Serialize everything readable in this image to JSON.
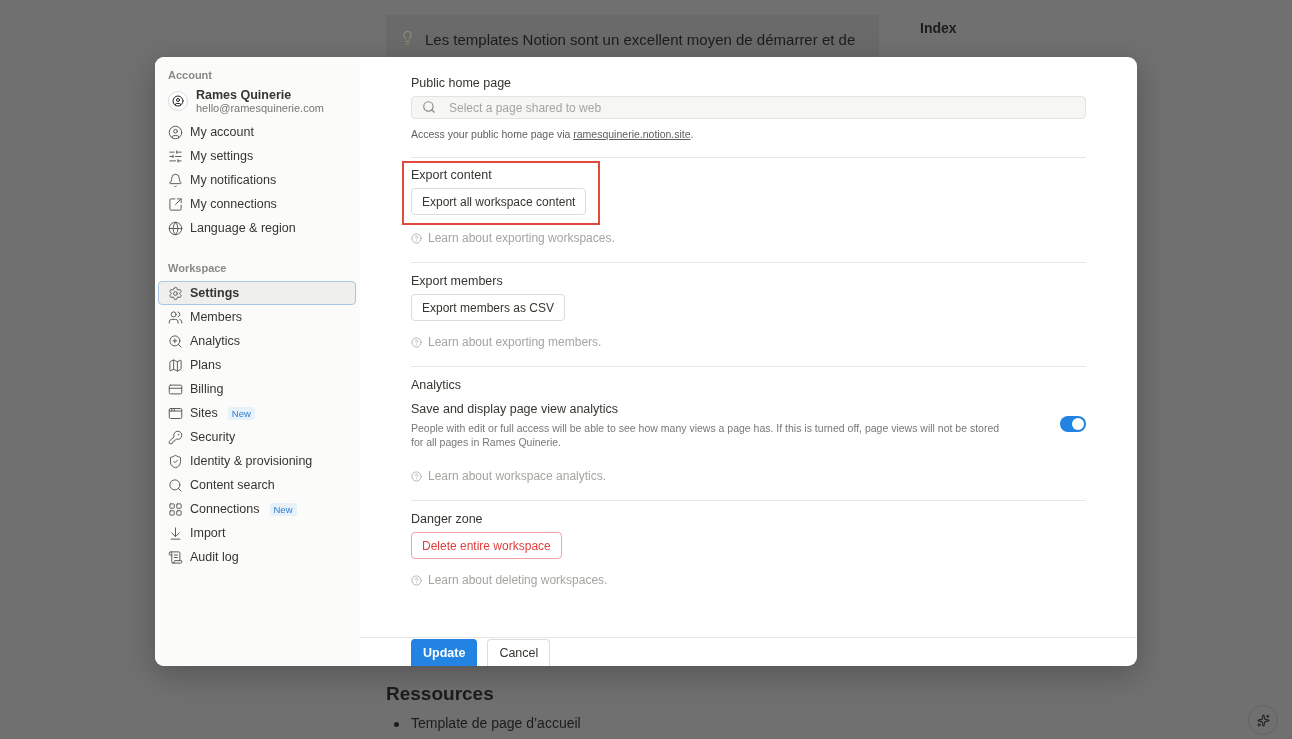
{
  "background": {
    "callout_text": "Les templates Notion sont un excellent moyen de démarrer et de",
    "index_title": "Index",
    "heading": "Ressources",
    "bullets": [
      "Template de page d’accueil"
    ]
  },
  "sidebar": {
    "account": {
      "title": "Account",
      "name": "Rames Quinerie",
      "email": "hello@ramesquinerie.com"
    },
    "sections": [
      {
        "items": [
          {
            "label": "My account",
            "selected": false
          },
          {
            "label": "My settings",
            "selected": false
          },
          {
            "label": "My notifications",
            "selected": false
          },
          {
            "label": "My connections",
            "selected": false
          },
          {
            "label": "Language & region",
            "selected": false
          }
        ]
      },
      {
        "title": "Workspace",
        "items": [
          {
            "label": "Settings",
            "selected": true
          },
          {
            "label": "Members",
            "selected": false
          },
          {
            "label": "Analytics",
            "selected": false
          },
          {
            "label": "Plans",
            "selected": false
          },
          {
            "label": "Billing",
            "selected": false
          },
          {
            "label": "Sites",
            "selected": false,
            "badge": "New"
          },
          {
            "label": "Security",
            "selected": false
          },
          {
            "label": "Identity & provisioning",
            "selected": false
          },
          {
            "label": "Content search",
            "selected": false
          },
          {
            "label": "Connections",
            "selected": false,
            "badge": "New"
          },
          {
            "label": "Import",
            "selected": false
          },
          {
            "label": "Audit log",
            "selected": false
          }
        ]
      }
    ]
  },
  "sections": [
    {
      "kind": "search_field",
      "title": "Public home page",
      "placeholder": "Select a page shared to web",
      "note": "Access your public home page via",
      "note_link": "ramesquinerie.notion.site",
      "note_end": "."
    },
    {
      "kind": "button",
      "title": "Export content",
      "button": "Export all workspace content",
      "help": "Learn about exporting workspaces.",
      "highlighted": true,
      "danger": false
    },
    {
      "kind": "button",
      "title": "Export members",
      "button": "Export members as CSV",
      "help": "Learn about exporting members.",
      "highlighted": false,
      "danger": false
    },
    {
      "kind": "toggle",
      "title": "Analytics",
      "setting_label": "Save and display page view analytics",
      "setting_description": "People with edit or full access will be able to see how many views a page has. If this is turned off, page views will not be stored for all pages in Rames Quinerie.",
      "on": true,
      "help": "Learn about workspace analytics."
    },
    {
      "kind": "button",
      "title": "Danger zone",
      "button": "Delete entire workspace",
      "help": "Learn about deleting workspaces.",
      "highlighted": false,
      "danger": true
    }
  ],
  "footer": [
    {
      "label": "Update",
      "primary": true
    },
    {
      "label": "Cancel",
      "primary": false
    }
  ]
}
